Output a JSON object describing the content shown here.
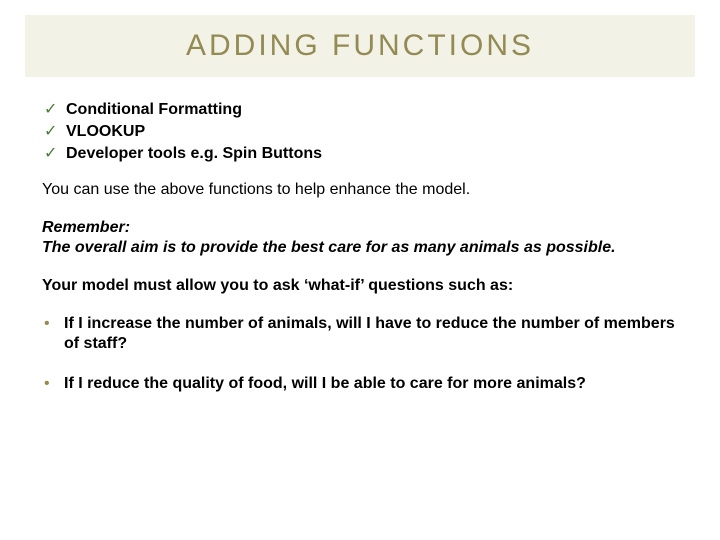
{
  "title": "ADDING FUNCTIONS",
  "checks": {
    "0": "Conditional Formatting",
    "1": "VLOOKUP",
    "2": "Developer tools e.g. Spin Buttons"
  },
  "intro": "You can use the above functions to help enhance the model.",
  "remember_label": "Remember:",
  "remember_text": "The overall aim is to provide the best care for as many animals as possible.",
  "whatif": "Your model must allow you to ask ‘what-if’ questions such as:",
  "bullets": {
    "0": "If I increase the number of animals, will I have to reduce the number of members of staff?",
    "1": "If I reduce the quality of food, will I be able to care for more animals?"
  }
}
